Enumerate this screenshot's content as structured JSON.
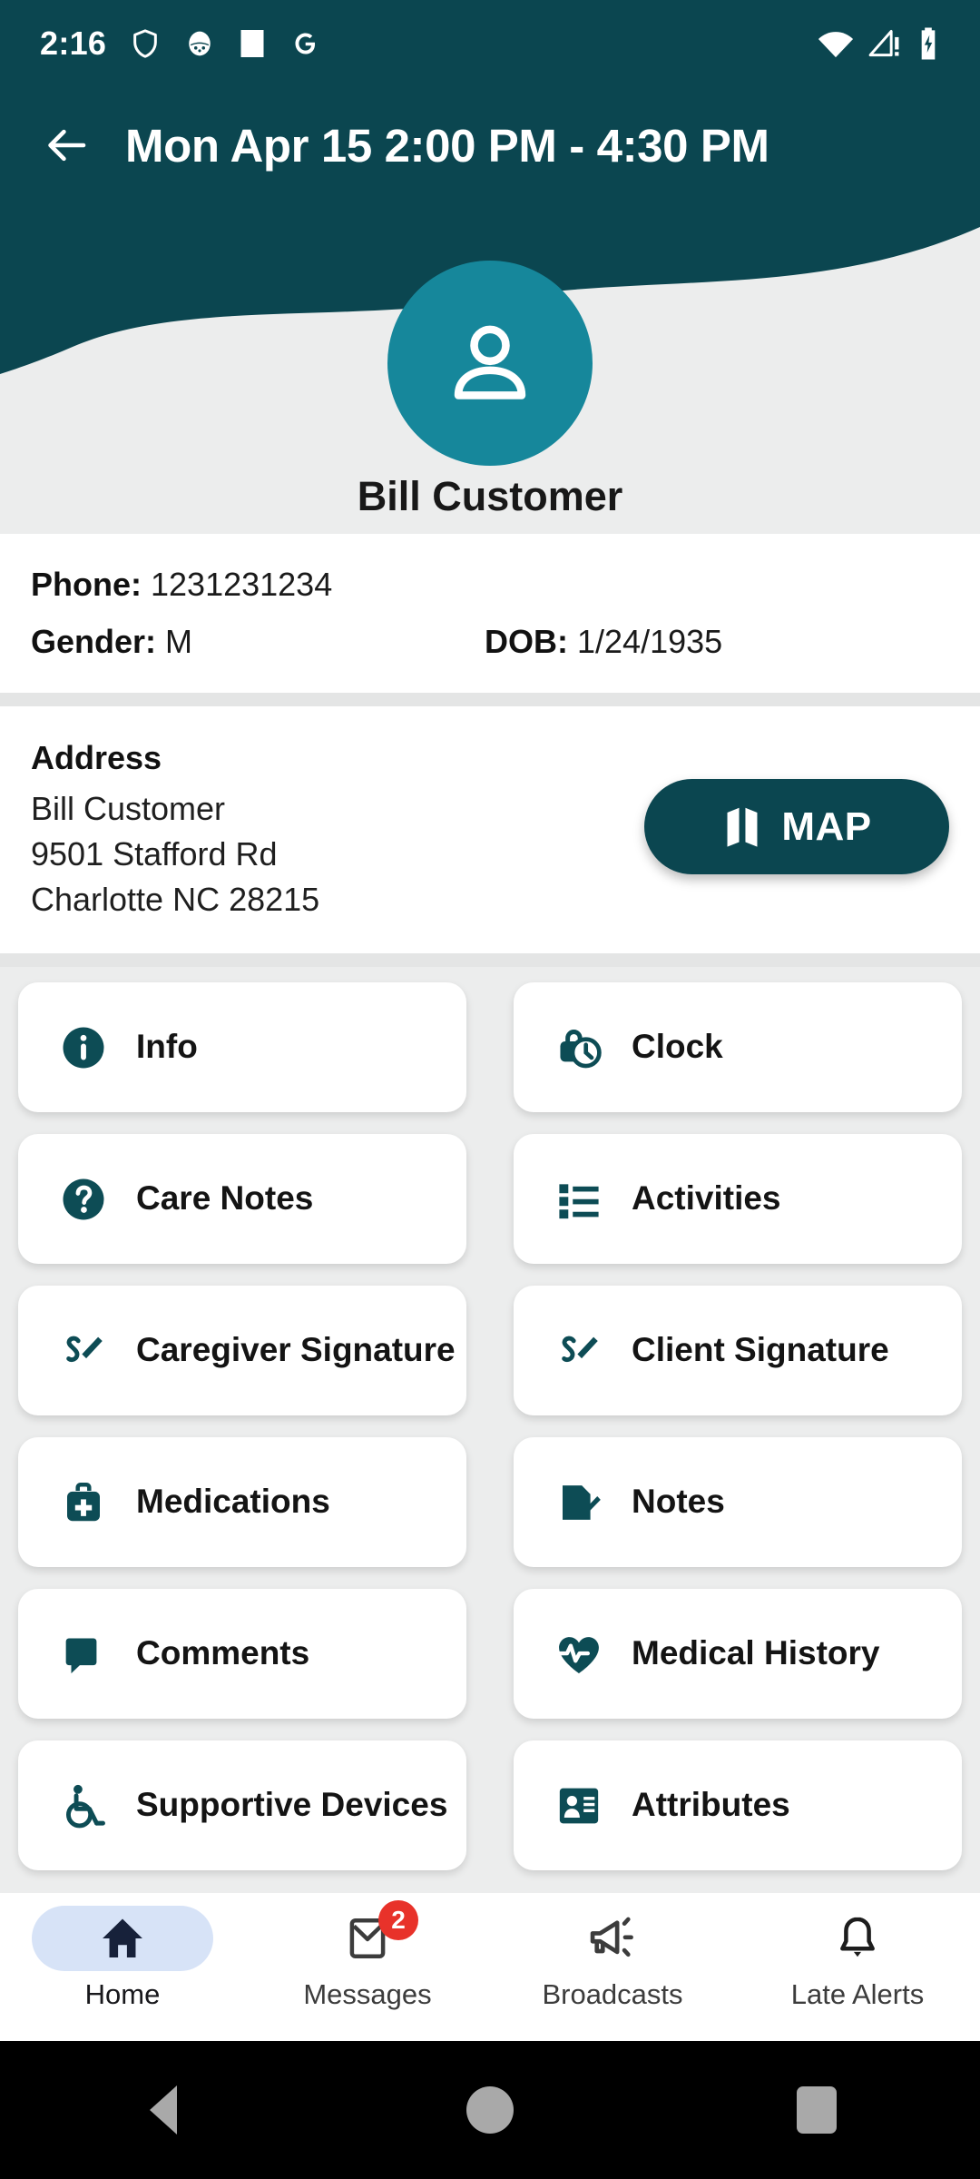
{
  "status_bar": {
    "time": "2:16",
    "left_icons": [
      "shield-icon",
      "face-icon",
      "white-square-icon",
      "google-g-icon"
    ],
    "right_icons": [
      "wifi-icon",
      "cellular-alert-icon",
      "battery-charging-icon"
    ]
  },
  "app_bar": {
    "back_icon": "back-arrow-icon",
    "title": "Mon Apr 15 2:00 PM - 4:30 PM"
  },
  "client": {
    "avatar_icon": "person-icon",
    "name": "Bill Customer"
  },
  "info": {
    "phone_label": "Phone:",
    "phone_value": "1231231234",
    "gender_label": "Gender:",
    "gender_value": "M",
    "dob_label": "DOB:",
    "dob_value": "1/24/1935"
  },
  "address": {
    "heading": "Address",
    "name": "Bill Customer",
    "street": "9501 Stafford Rd",
    "city_state_zip": "Charlotte NC 28215",
    "map_button_label": "MAP",
    "map_button_icon": "map-icon"
  },
  "grid": {
    "cards": [
      {
        "label": "Info",
        "icon": "info-circle-icon"
      },
      {
        "label": "Clock",
        "icon": "lock-clock-icon"
      },
      {
        "label": "Care Notes",
        "icon": "question-circle-icon"
      },
      {
        "label": "Activities",
        "icon": "list-icon"
      },
      {
        "label": "Caregiver Signature",
        "icon": "signature-icon"
      },
      {
        "label": "Client Signature",
        "icon": "signature-icon"
      },
      {
        "label": "Medications",
        "icon": "medical-bag-icon"
      },
      {
        "label": "Notes",
        "icon": "note-edit-icon"
      },
      {
        "label": "Comments",
        "icon": "comment-bubble-icon"
      },
      {
        "label": "Medical History",
        "icon": "heart-pulse-icon"
      },
      {
        "label": "Supportive Devices",
        "icon": "wheelchair-icon"
      },
      {
        "label": "Attributes",
        "icon": "id-card-icon"
      }
    ]
  },
  "bottom_nav": {
    "items": [
      {
        "label": "Home",
        "icon": "home-icon",
        "active": true,
        "badge": ""
      },
      {
        "label": "Messages",
        "icon": "message-icon",
        "active": false,
        "badge": "2"
      },
      {
        "label": "Broadcasts",
        "icon": "megaphone-icon",
        "active": false,
        "badge": ""
      },
      {
        "label": "Late Alerts",
        "icon": "bell-icon",
        "active": false,
        "badge": ""
      }
    ]
  },
  "android_nav": {
    "back": "android-back-icon",
    "home": "android-home-icon",
    "recents": "android-recents-icon"
  },
  "colors": {
    "header_teal": "#0b4650",
    "avatar_teal": "#16879b",
    "icon_teal": "#0d4c55",
    "page_bg": "#eceded",
    "badge_red": "#e8322a",
    "nav_active_pill": "#d7e3f7"
  }
}
